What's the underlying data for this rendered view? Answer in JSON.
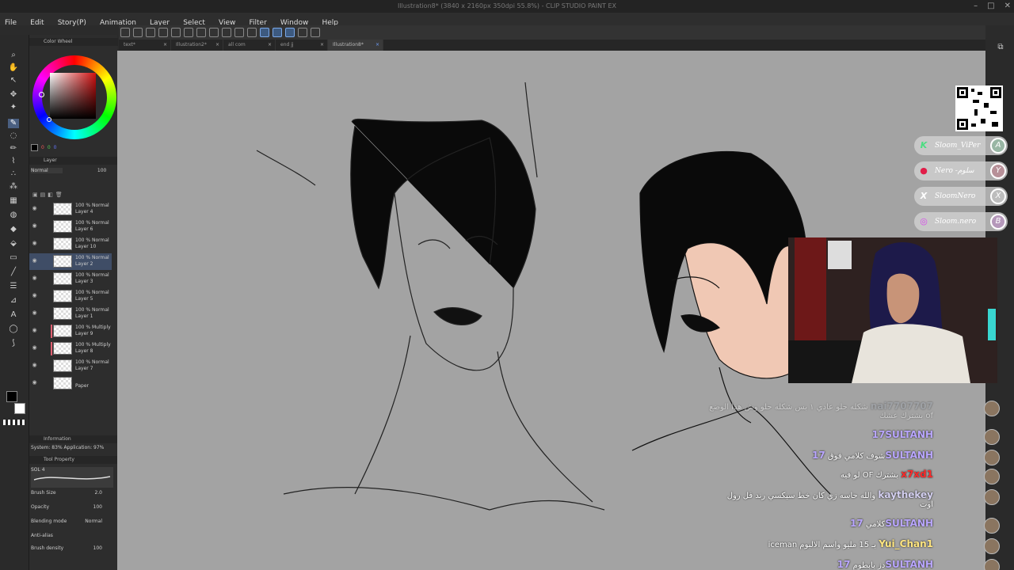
{
  "window": {
    "title": "Illustration8* (3840 x 2160px 350dpi 55.8%)  - CLIP STUDIO PAINT EX"
  },
  "menu": [
    "File",
    "Edit",
    "Story(P)",
    "Animation",
    "Layer",
    "Select",
    "View",
    "Filter",
    "Window",
    "Help"
  ],
  "tabs": [
    {
      "label": "text*",
      "active": false
    },
    {
      "label": "Illustration2*",
      "active": false
    },
    {
      "label": "all com",
      "active": false
    },
    {
      "label": "end jj",
      "active": false
    },
    {
      "label": "Illustration8*",
      "active": true
    }
  ],
  "color_wheel": {
    "title": "Color Wheel",
    "values": [
      "0",
      "0",
      "0"
    ],
    "current_color": "#000000",
    "hue_color": "#d01010"
  },
  "layer_panel": {
    "title": "Layer",
    "opacity_value": "100",
    "blend_mode": "Normal",
    "layers": [
      {
        "mode": "100 % Normal",
        "name": "Layer 4",
        "selected": false,
        "marked": false
      },
      {
        "mode": "100 % Normal",
        "name": "Layer 6",
        "selected": false,
        "marked": false
      },
      {
        "mode": "100 % Normal",
        "name": "Layer 10",
        "selected": false,
        "marked": false
      },
      {
        "mode": "100 % Normal",
        "name": "Layer 2",
        "selected": true,
        "marked": false
      },
      {
        "mode": "100 % Normal",
        "name": "Layer 3",
        "selected": false,
        "marked": false
      },
      {
        "mode": "100 % Normal",
        "name": "Layer 5",
        "selected": false,
        "marked": false
      },
      {
        "mode": "100 % Normal",
        "name": "Layer 1",
        "selected": false,
        "marked": false
      },
      {
        "mode": "100 % Multiply",
        "name": "Layer 9",
        "selected": false,
        "marked": true
      },
      {
        "mode": "100 % Multiply",
        "name": "Layer 8",
        "selected": false,
        "marked": true
      },
      {
        "mode": "100 % Normal",
        "name": "Layer 7",
        "selected": false,
        "marked": false
      },
      {
        "mode": "",
        "name": "Paper",
        "selected": false,
        "marked": false
      }
    ]
  },
  "information": {
    "title": "Information",
    "system": "System: 83%  Application: 97%"
  },
  "tool_property": {
    "title": "Tool Property",
    "brush_name": "SOL 4",
    "brush_size_label": "Brush Size",
    "brush_size": "2.0",
    "opacity_label": "Opacity",
    "opacity": "100",
    "blending_label": "Blending mode",
    "blending": "Normal",
    "antialias_label": "Anti-alias",
    "density_label": "Brush density",
    "density": "100"
  },
  "overlay": {
    "socials": [
      {
        "icon": "K",
        "handle": "Sloom_ViPer",
        "badge": "A",
        "color": "#4ade80"
      },
      {
        "icon": "●",
        "handle": "Nero -ﺳﻠﻮﻡ",
        "badge": "Y",
        "color": "#e11d48"
      },
      {
        "icon": "X",
        "handle": "SloomNero",
        "badge": "X",
        "color": "#ffffff"
      },
      {
        "icon": "◎",
        "handle": "Sloom.nero",
        "badge": "B",
        "color": "#d946ef"
      }
    ]
  },
  "chat": [
    {
      "user": "nai7707707",
      "text": "شكله حلو عادي ١ بس شكله حلو وش هذا الوضع",
      "extra": "بشترك عشك of",
      "user_color": "#9aa0a8",
      "dim": true
    },
    {
      "user": "17SULTANH",
      "text": "",
      "extra": "",
      "user_color": "#b9a6ff",
      "dim": false
    },
    {
      "user": "17SULTANH",
      "text": "شوف كلامي فوق",
      "extra": "",
      "user_color": "#b9a6ff",
      "dim": false
    },
    {
      "user": "x7xd1",
      "text": "لو فيه OF بشترك",
      "extra": "",
      "user_color": "#ff2a2a",
      "dim": false
    },
    {
      "user": "kaythekey",
      "text": "والله حاسه زي كان خط سيكسي رند فل رول",
      "extra": "اوت",
      "user_color": "#d4d0f0",
      "dim": false
    },
    {
      "user": "17SULTANH",
      "text": "كلامي",
      "extra": "",
      "user_color": "#b9a6ff",
      "dim": false
    },
    {
      "user": "Yui_Chan1",
      "text": "iceman بـ 15 مليو واسم الالبوم",
      "extra": "",
      "user_color": "#ffe680",
      "dim": false
    },
    {
      "user": "17SULTANH",
      "text": "دز بابطوم",
      "extra": "",
      "user_color": "#b9a6ff",
      "dim": false
    }
  ]
}
